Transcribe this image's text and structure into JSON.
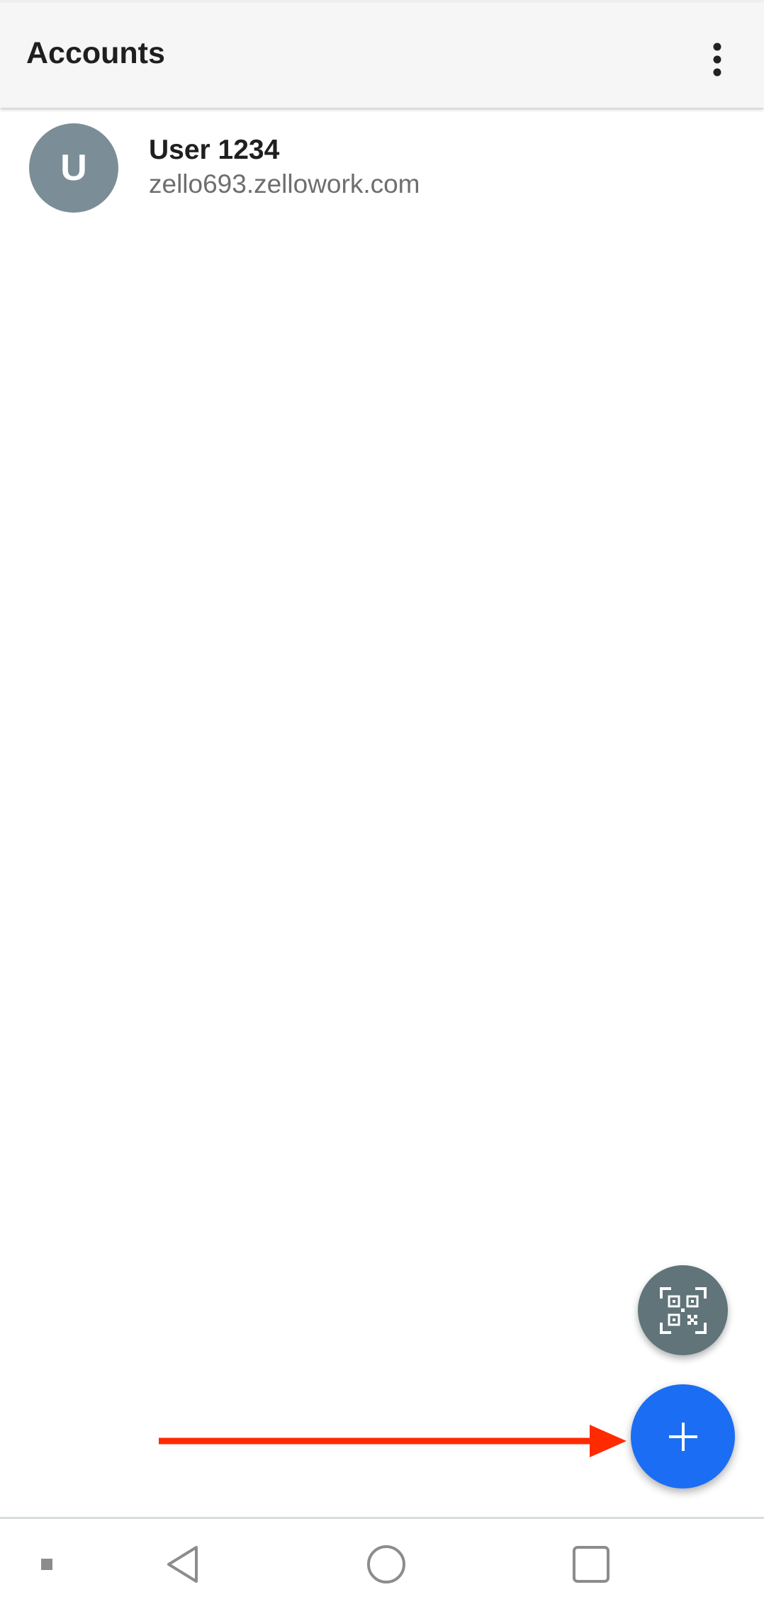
{
  "app_bar": {
    "title": "Accounts",
    "overflow_icon": "more-vert-icon"
  },
  "accounts": [
    {
      "avatar_letter": "U",
      "name": "User 1234",
      "host": "zello693.zellowork.com"
    }
  ],
  "fabs": {
    "scan_icon": "qr-scan-icon",
    "add_icon": "plus-icon"
  },
  "nav": {
    "items": [
      "recents-dot-icon",
      "back-icon",
      "home-icon",
      "overview-icon"
    ]
  },
  "colors": {
    "avatar": "#7b8d96",
    "fab_scan": "#607479",
    "fab_add": "#1b6ef3",
    "annotation_arrow": "#ff2a00"
  }
}
